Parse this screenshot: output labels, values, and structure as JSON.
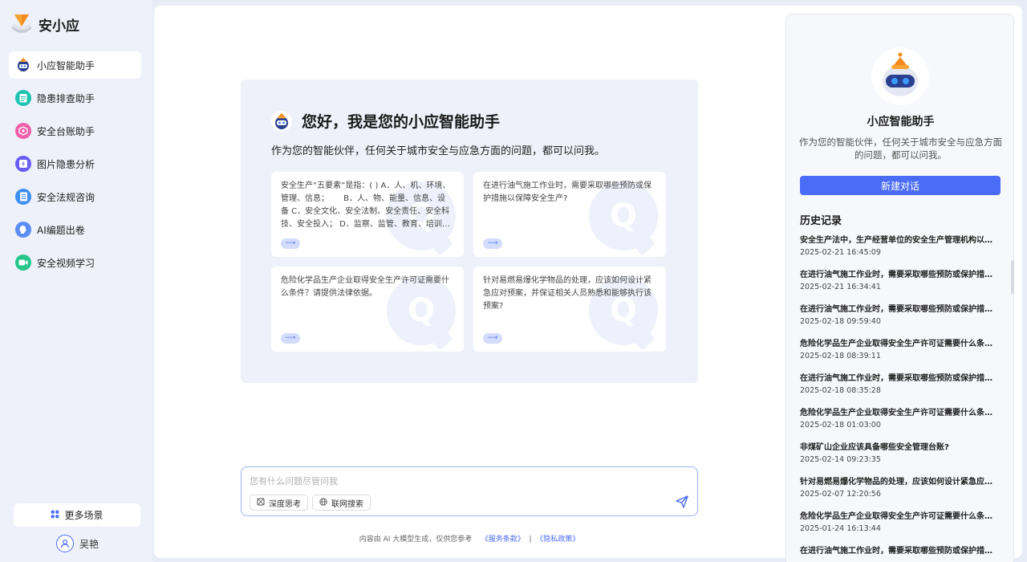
{
  "brand": {
    "name": "安小应"
  },
  "sidebar": {
    "items": [
      {
        "label": "小应智能助手",
        "icon": "robot-icon",
        "color": "#ffffff",
        "glyph": "🤖"
      },
      {
        "label": "隐患排查助手",
        "icon": "clipboard-icon",
        "color": "#1ec3b2",
        "glyph": "▤"
      },
      {
        "label": "安全台账助手",
        "icon": "ledger-icon",
        "color": "#f05fa8",
        "glyph": "◈"
      },
      {
        "label": "图片隐患分析",
        "icon": "image-analysis-icon",
        "color": "#6a5cf5",
        "glyph": "⚡"
      },
      {
        "label": "安全法规咨询",
        "icon": "regulation-icon",
        "color": "#3d8ef5",
        "glyph": "▦"
      },
      {
        "label": "AI编题出卷",
        "icon": "ai-exam-icon",
        "color": "#5b8df7",
        "glyph": "◉"
      },
      {
        "label": "安全视频学习",
        "icon": "video-icon",
        "color": "#27c48b",
        "glyph": "▶"
      }
    ],
    "more": "更多场景",
    "user": "吴艳"
  },
  "welcome": {
    "title": "您好，我是您的小应智能助手",
    "subtitle": "作为您的智能伙伴，任何关于城市安全与应急方面的问题，都可以问我。",
    "questions": [
      "安全生产“五要素”是指：( ) A．人、机、环境、管理、信息；　　 B．人、物、能量、信息、设备 C．安全文化、安全法制、安全责任、安全科技、安全投入； D．监察、监管、教育、培训、管理",
      "在进行油气施工作业时，需要采取哪些预防或保护措施以保障安全生产?",
      "危险化学品生产企业取得安全生产许可证需要什么条件？请提供法律依据。",
      "针对易燃易爆化学物品的处理，应该如何设计紧急应对预案，并保证相关人员熟悉和能够执行该预案?"
    ],
    "q_letter": "Q",
    "arrow": "⟶"
  },
  "input": {
    "placeholder": "您有什么问题尽管问我",
    "deep_think": "深度思考",
    "web_search": "联网搜索"
  },
  "footer": {
    "note": "内容由 AI 大模型生成，仅供您参考",
    "terms": "《服务条款》",
    "sep": "|",
    "privacy": "《隐私政策》"
  },
  "right": {
    "name": "小应智能助手",
    "desc": "作为您的智能伙伴，任何关于城市安全与应急方面的问题，都可以问我。",
    "new_chat": "新建对话",
    "history_title": "历史记录",
    "history": [
      {
        "title": "安全生产法中，生产经营单位的安全生产管理机构以及安全生产管理人员的职责",
        "time": "2025-02-21 16:45:09"
      },
      {
        "title": "在进行油气施工作业时，需要采取哪些预防或保护措施以保障安全生产?",
        "time": "2025-02-21 16:34:41"
      },
      {
        "title": "在进行油气施工作业时，需要采取哪些预防或保护措施以保障安全生产?",
        "time": "2025-02-18 09:59:40"
      },
      {
        "title": "危险化学品生产企业取得安全生产许可证需要什么条件？请提供法律依据。",
        "time": "2025-02-18 08:39:11"
      },
      {
        "title": "在进行油气施工作业时，需要采取哪些预防或保护措施以保障安全生产?",
        "time": "2025-02-18 08:35:28"
      },
      {
        "title": "危险化学品生产企业取得安全生产许可证需要什么条件？请提供法律依据。",
        "time": "2025-02-18 01:03:00"
      },
      {
        "title": "非煤矿山企业应该具备哪些安全管理台账?",
        "time": "2025-02-14 09:23:35"
      },
      {
        "title": "针对易燃易爆化学物品的处理，应该如何设计紧急应对预案，并保证相关人员熟悉和能够执行该预案?",
        "time": "2025-02-07 12:20:56"
      },
      {
        "title": "危险化学品生产企业取得安全生产许可证需要什么条件？请提供法律依据。",
        "time": "2025-01-24 16:13:44"
      },
      {
        "title": "在进行油气施工作业时，需要采取哪些预防或保护措施以保障安全生产?",
        "time": ""
      }
    ]
  },
  "colors": {
    "accent": "#4a6cf7",
    "card_bg": "#eef1f9"
  }
}
